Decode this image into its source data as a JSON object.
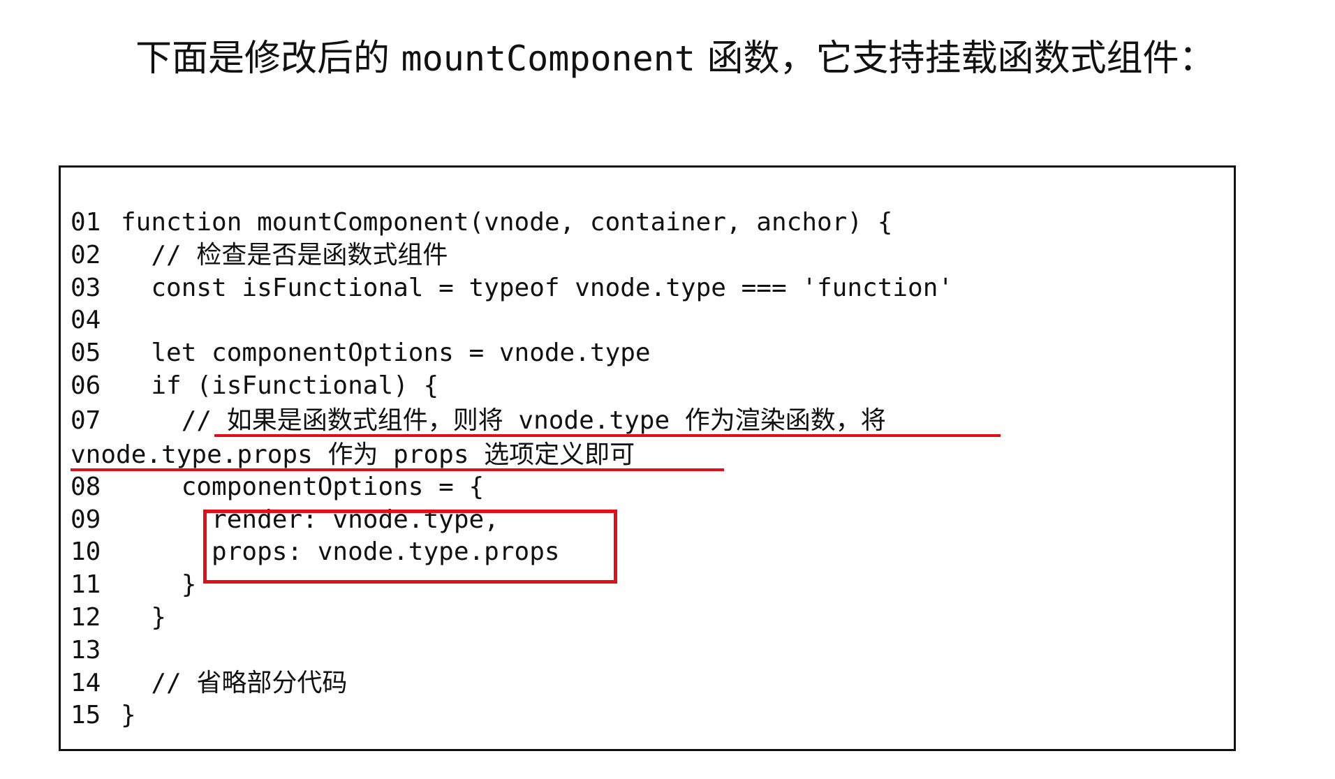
{
  "intro": {
    "part1": "下面是修改后的 ",
    "code_word": "mountComponent",
    "part2": " 函数，它支持挂载函数式组件："
  },
  "code": {
    "lines": [
      {
        "no": "01",
        "text": "function mountComponent(vnode, container, anchor) {"
      },
      {
        "no": "02",
        "text": "  // 检查是否是函数式组件"
      },
      {
        "no": "03",
        "text": "  const isFunctional = typeof vnode.type === 'function'"
      },
      {
        "no": "04",
        "text": ""
      },
      {
        "no": "05",
        "text": "  let componentOptions = vnode.type"
      },
      {
        "no": "06",
        "text": "  if (isFunctional) {"
      },
      {
        "no": "07",
        "text": "    // 如果是函数式组件，则将 vnode.type 作为渲染函数，将"
      },
      {
        "no": "",
        "text": "vnode.type.props 作为 props 选项定义即可"
      },
      {
        "no": "08",
        "text": "    componentOptions = {"
      },
      {
        "no": "09",
        "text": "      render: vnode.type,"
      },
      {
        "no": "10",
        "text": "      props: vnode.type.props"
      },
      {
        "no": "11",
        "text": "    }"
      },
      {
        "no": "12",
        "text": "  }"
      },
      {
        "no": "13",
        "text": ""
      },
      {
        "no": "14",
        "text": "  // 省略部分代码"
      },
      {
        "no": "15",
        "text": "}"
      }
    ]
  },
  "annotation_color": "#e0101a"
}
